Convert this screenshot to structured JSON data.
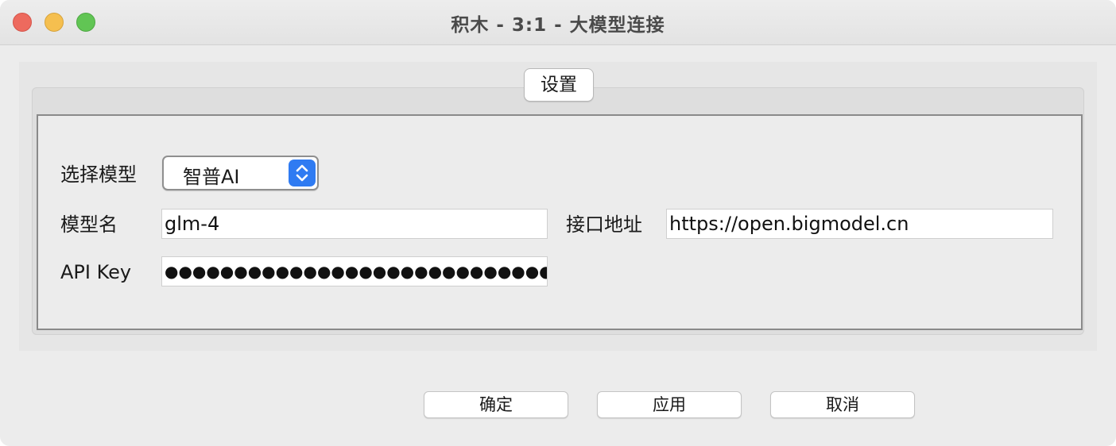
{
  "window": {
    "title": "积木 - 3:1 - 大模型连接",
    "controls": [
      "close",
      "minimize",
      "maximize"
    ]
  },
  "tabs": [
    {
      "label": "设置",
      "selected": true
    }
  ],
  "form": {
    "model_select": {
      "label": "选择模型",
      "value": "智普AI"
    },
    "model_name": {
      "label": "模型名",
      "value": "glm-4"
    },
    "endpoint": {
      "label": "接口地址",
      "value": "https://open.bigmodel.cn"
    },
    "api_key": {
      "label": "API Key",
      "value": "●●●●●●●●●●●●●●●●●●●●●●●●●●●●●●"
    }
  },
  "buttons": {
    "ok": "确定",
    "apply": "应用",
    "cancel": "取消"
  },
  "colors": {
    "close": "#ed6a5e",
    "minimize": "#f5bf4f",
    "maximize": "#61c554",
    "accent": "#2f7bf2"
  }
}
